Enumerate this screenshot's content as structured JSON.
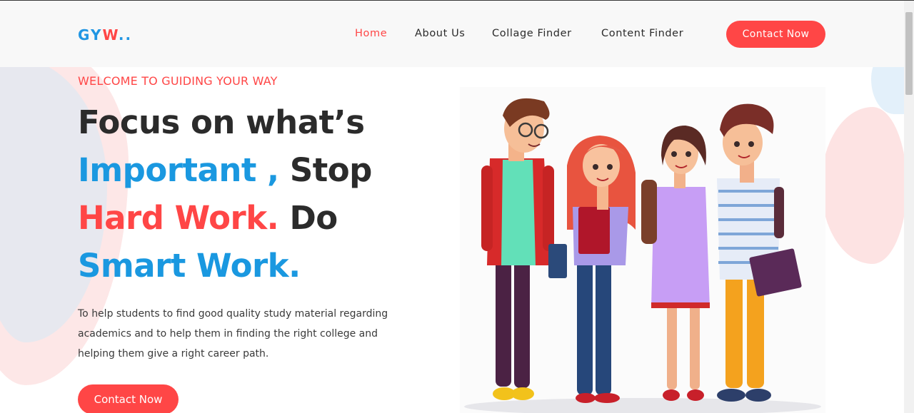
{
  "brand": {
    "logo_part1": "GY",
    "logo_part2": "W",
    "logo_dots": ".."
  },
  "nav": {
    "items": [
      {
        "label": "Home",
        "active": true
      },
      {
        "label": "About Us",
        "active": false
      },
      {
        "label": "Collage Finder",
        "active": false
      },
      {
        "label": "Content Finder",
        "active": false
      }
    ],
    "cta_label": "Contact Now"
  },
  "hero": {
    "welcome": "WELCOME TO GUIDING YOUR WAY",
    "headline": {
      "line1": "Focus on what’s",
      "line2_blue": "Important ,",
      "line2_dark": "Stop",
      "line3_red": "Hard Work.",
      "line3_dark": "Do",
      "line4_blue": "Smart Work."
    },
    "description": "To help students to find good quality study material regarding academics and to help them in finding the right college and helping them give a right career path.",
    "cta_label": "Contact Now"
  },
  "illustration": {
    "icon": "students-group-illustration"
  },
  "colors": {
    "accent_red": "#ff4646",
    "accent_blue": "#1a98e0",
    "text_dark": "#2b2b2b"
  }
}
